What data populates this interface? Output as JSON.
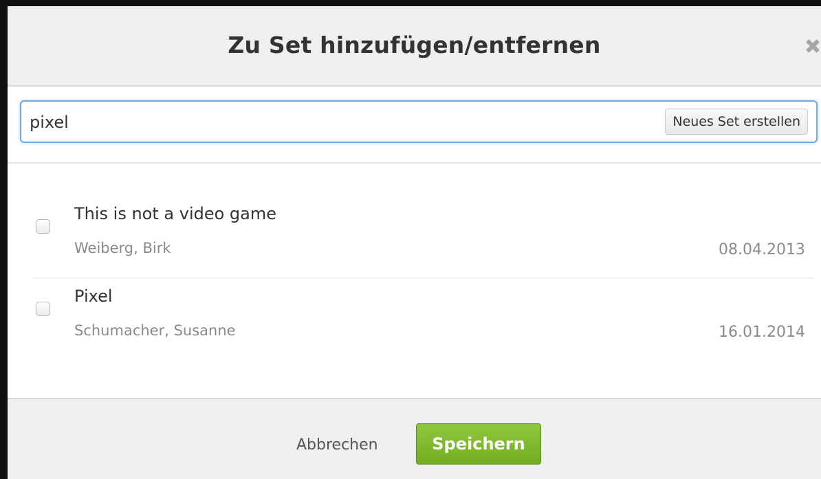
{
  "dialog": {
    "title": "Zu Set hinzufügen/entfernen",
    "close_icon": "close-icon"
  },
  "search": {
    "value": "pixel",
    "new_set_label": "Neues Set erstellen",
    "focus_color": "#74a9dd"
  },
  "sets": [
    {
      "title": "This is not a video game",
      "owner": "Weiberg, Birk",
      "date": "08.04.2013",
      "checked": false
    },
    {
      "title": "Pixel",
      "owner": "Schumacher, Susanne",
      "date": "16.01.2014",
      "checked": false
    }
  ],
  "footer": {
    "cancel_label": "Abbrechen",
    "save_label": "Speichern",
    "save_color": "#7db52e"
  }
}
